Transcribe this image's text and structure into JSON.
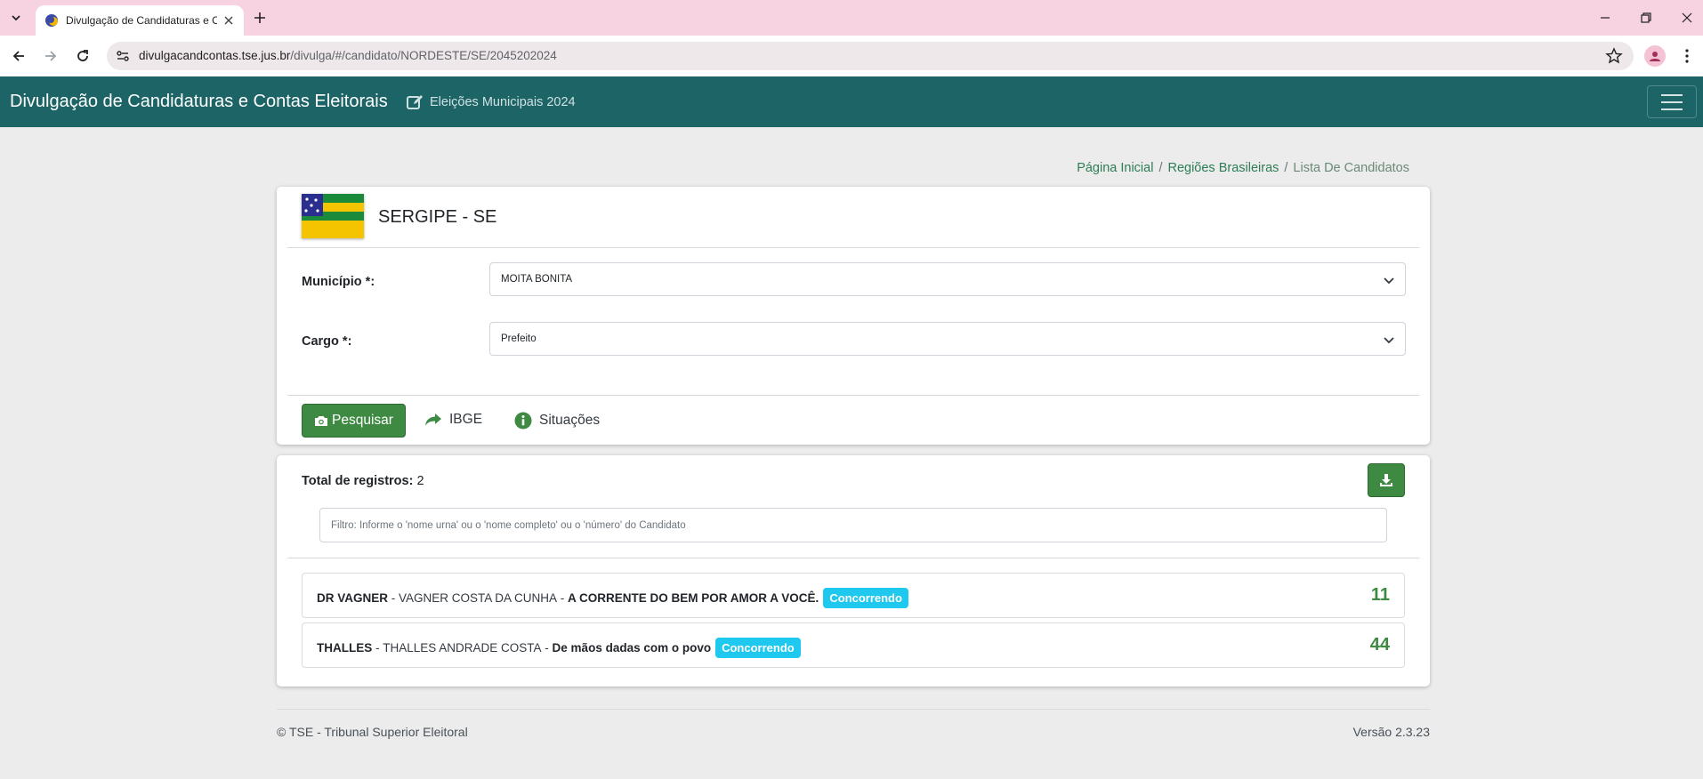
{
  "browser": {
    "tab_title": "Divulgação de Candidaturas e C",
    "url_domain": "divulgacandcontas.tse.jus.br",
    "url_path": "/divulga/#/candidato/NORDESTE/SE/2045202024"
  },
  "header": {
    "brand": "Divulgação de Candidaturas e Contas Eleitorais",
    "subtitle": "Eleições Municipais 2024"
  },
  "breadcrumb": {
    "home": "Página Inicial",
    "regions": "Regiões Brasileiras",
    "current": "Lista De Candidatos",
    "separator": "/"
  },
  "state": {
    "title": "SERGIPE - SE"
  },
  "form": {
    "municipio_label": "Município *:",
    "municipio_value": "MOITA BONITA",
    "cargo_label": "Cargo *:",
    "cargo_value": "Prefeito"
  },
  "actions": {
    "search_label": "Pesquisar",
    "ibge_label": "IBGE",
    "situacoes_label": "Situações"
  },
  "results": {
    "total_label": "Total de registros:",
    "total_value": "2",
    "filter_placeholder": "Filtro: Informe o 'nome urna' ou o 'nome completo' ou o 'número' do Candidato",
    "candidates": [
      {
        "urna_name": "DR VAGNER",
        "full_name": "VAGNER COSTA DA CUNHA",
        "coalition": "A CORRENTE DO BEM POR AMOR A VOCÊ.",
        "status": "Concorrendo",
        "number": "11",
        "sep": " - "
      },
      {
        "urna_name": "THALLES",
        "full_name": "THALLES ANDRADE COSTA",
        "coalition": "De mãos dadas com o povo",
        "status": "Concorrendo",
        "number": "44",
        "sep": " - "
      }
    ]
  },
  "footer": {
    "copyright": "© TSE - Tribunal Superior Eleitoral",
    "version": "Versão 2.3.23"
  },
  "colors": {
    "navbar": "#1d6466",
    "primary_button": "#3e8a42",
    "badge": "#1ec8ee",
    "tab_strip": "#f7d3e1"
  }
}
